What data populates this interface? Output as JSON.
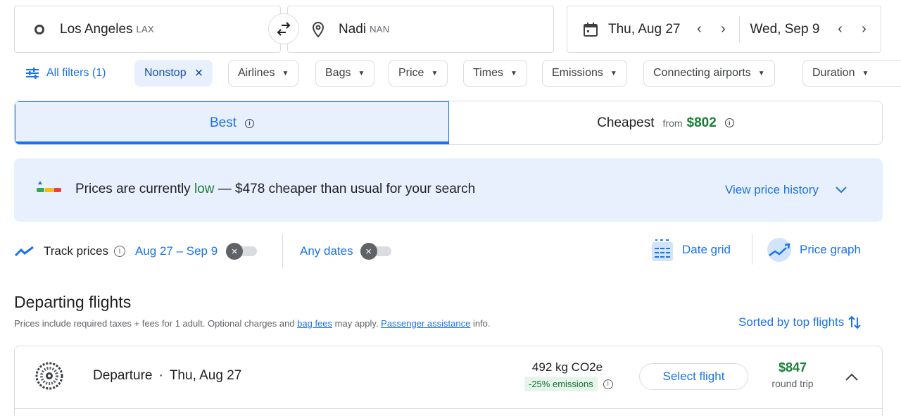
{
  "search": {
    "origin": {
      "city": "Los Angeles",
      "code": "LAX"
    },
    "destination": {
      "city": "Nadi",
      "code": "NAN"
    },
    "depart_date": "Thu, Aug 27",
    "return_date": "Wed, Sep 9"
  },
  "filters": {
    "all_filters": "All filters (1)",
    "chips": [
      {
        "label": "Nonstop",
        "active": true
      },
      {
        "label": "Airlines"
      },
      {
        "label": "Bags"
      },
      {
        "label": "Price"
      },
      {
        "label": "Times"
      },
      {
        "label": "Emissions"
      },
      {
        "label": "Connecting airports"
      },
      {
        "label": "Duration"
      }
    ]
  },
  "tabs": {
    "best": "Best",
    "cheapest": "Cheapest",
    "cheapest_from": "from",
    "cheapest_price": "$802"
  },
  "banner": {
    "prefix": "Prices are currently ",
    "level": "low",
    "suffix": " — $478 cheaper than usual for your search",
    "history_link": "View price history"
  },
  "tracking": {
    "label": "Track prices",
    "range": "Aug 27 – Sep 9",
    "any_dates": "Any dates",
    "date_grid": "Date grid",
    "price_graph": "Price graph"
  },
  "results": {
    "heading": "Departing flights",
    "note_prefix": "Prices include required taxes + fees for 1 adult. Optional charges and ",
    "bag_fees": "bag fees",
    "note_mid": " may apply. ",
    "passenger_assistance": "Passenger assistance",
    "note_suffix": " info.",
    "sort_label": "Sorted by top flights"
  },
  "flight": {
    "departure_label": "Departure",
    "separator": "·",
    "date": "Thu, Aug 27",
    "emissions": "492 kg CO2e",
    "emissions_delta": "-25% emissions",
    "select": "Select flight",
    "price": "$847",
    "price_note": "round trip"
  },
  "colors": {
    "accent": "#1a73e8",
    "price_green": "#188038",
    "low_green": "#188038"
  }
}
